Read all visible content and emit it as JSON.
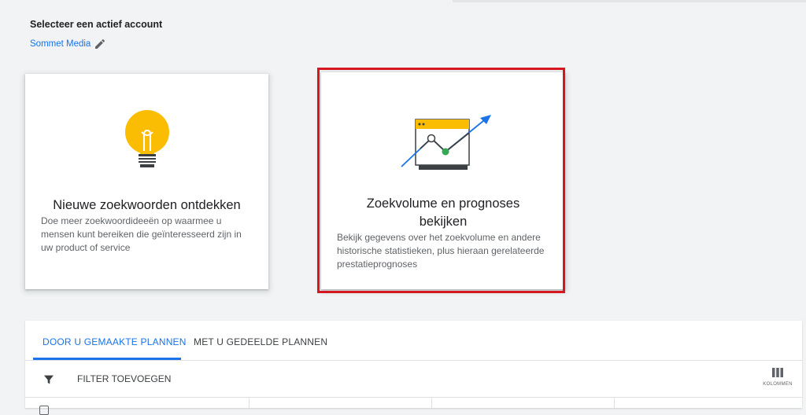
{
  "account": {
    "heading": "Selecteer een actief account",
    "name": "Sommet Media",
    "edit_icon": "pencil-icon"
  },
  "cards": {
    "discover": {
      "icon": "lightbulb-icon",
      "title": "Nieuwe zoekwoorden ontdekken",
      "description": "Doe meer zoekwoordideeën op waarmee u mensen kunt bereiken die geïnteresseerd zijn in uw product of service"
    },
    "forecast": {
      "icon": "trend-chart-icon",
      "title": "Zoekvolume en prognoses bekijken",
      "description": "Bekijk gegevens over het zoekvolume en andere historische statistieken, plus hieraan gerelateerde prestatieprognoses"
    }
  },
  "plans": {
    "tabs": [
      {
        "label": "DOOR U GEMAAKTE PLANNEN",
        "active": true
      },
      {
        "label": "MET U GEDEELDE PLANNEN",
        "active": false
      }
    ],
    "filter_label": "FILTER TOEVOEGEN",
    "columns_label": "KOLOMMEN"
  },
  "colors": {
    "accent": "#1a73e8",
    "highlight": "#d5171f",
    "bulb": "#fbbc04",
    "chart_green": "#34a853"
  }
}
